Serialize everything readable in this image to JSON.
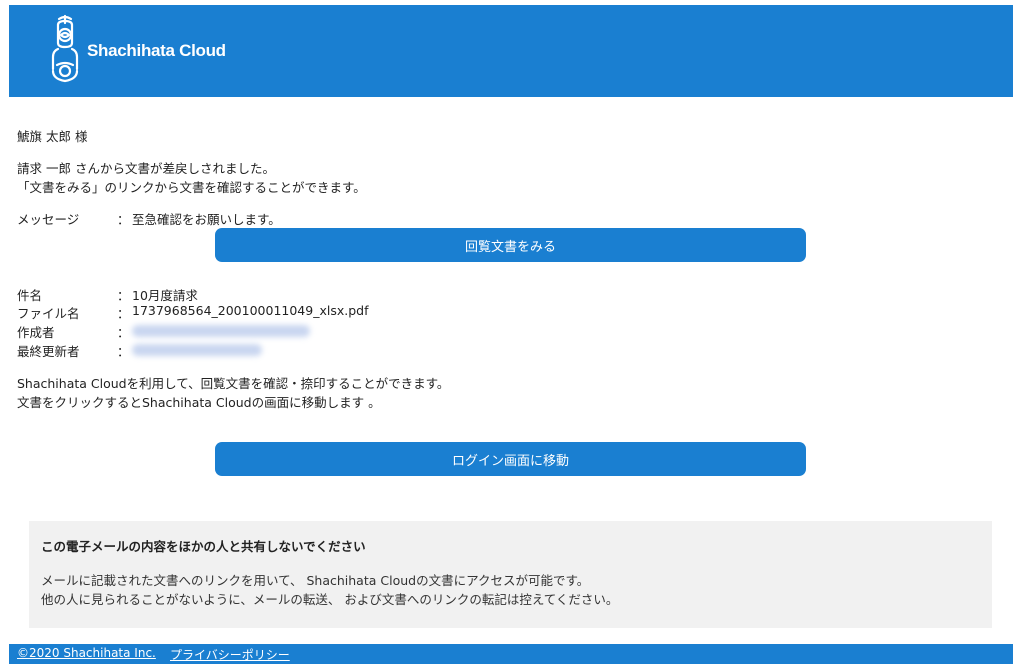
{
  "header": {
    "logo_text": "Shachihata Cloud"
  },
  "greeting": "鯱旗 太郎 様",
  "intro": {
    "line1": "請求 一郎 さんから文書が差戻しされました。",
    "line2": "「文書をみる」のリンクから文書を確認することができます。"
  },
  "message": {
    "label": "メッセージ",
    "colon": "：",
    "value": "至急確認をお願いします。"
  },
  "view_button_label": "回覧文書をみる",
  "details": {
    "subject_label": "件名",
    "subject_value": "10月度請求",
    "filename_label": "ファイル名",
    "filename_value": "1737968564_200100011049_xlsx.pdf",
    "author_label": "作成者",
    "updater_label": "最終更新者",
    "colon": "："
  },
  "info": {
    "line1": "Shachihata Cloudを利用して、回覧文書を確認・捺印することができます。",
    "line2": "文書をクリックするとShachihata Cloudの画面に移動します 。"
  },
  "login_button_label": "ログイン画面に移動",
  "notice": {
    "title": "この電子メールの内容をほかの人と共有しないでください",
    "line1": "メールに記載された文書へのリンクを用いて、 Shachihata Cloudの文書にアクセスが可能です。",
    "line2": "他の人に見られることがないように、メールの転送、 および文書へのリンクの転記は控えてください。"
  },
  "footer": {
    "copyright": "©2020 Shachihata Inc.",
    "privacy": "プライバシーポリシー"
  },
  "colors": {
    "brand": "#1a7fd1",
    "notice_bg": "#f1f1f1"
  },
  "icons": {
    "logo": "shachihata-logo-icon"
  }
}
